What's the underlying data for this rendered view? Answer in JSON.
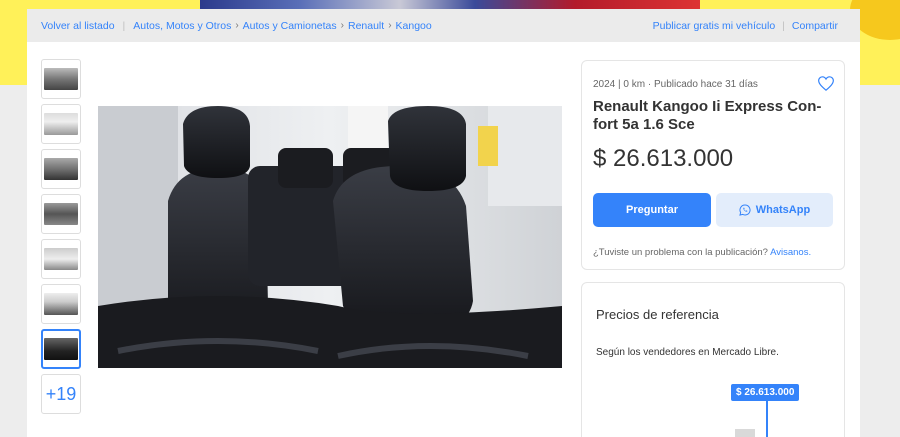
{
  "breadcrumb": {
    "back_label": "Volver al listado",
    "items": [
      "Autos, Motos y Otros",
      "Autos y Camionetas",
      "Renault",
      "Kangoo"
    ],
    "publish_label": "Publicar gratis mi vehículo",
    "share_label": "Compartir"
  },
  "gallery": {
    "thumbnails": [
      "photo-1",
      "photo-2",
      "photo-3",
      "photo-4",
      "photo-5",
      "photo-6",
      "photo-7"
    ],
    "selected_index": 6,
    "more_label": "+19"
  },
  "listing": {
    "subtitle": "2024 | 0 km · Publicado hace 31 días",
    "title": "Renault Kangoo Ii Express Con-fort 5a 1.6 Sce",
    "price": "$ 26.613.000",
    "ask_button": "Preguntar",
    "whatsapp_button": "WhatsApp",
    "problem_text": "¿Tuviste un problema con la publicación?",
    "problem_link": "Avisanos."
  },
  "reference_prices": {
    "title": "Precios de referencia",
    "subtitle": "Según los vendedores en Mercado Libre.",
    "badge": "$ 26.613.000"
  },
  "colors": {
    "accent": "#3483fa",
    "banner_yellow": "#fff159"
  }
}
